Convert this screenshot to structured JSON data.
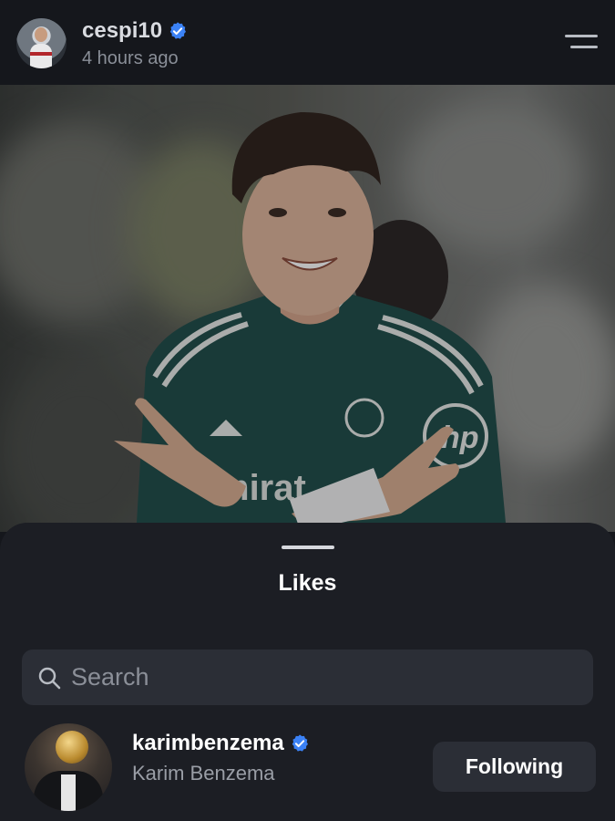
{
  "post": {
    "username": "cespi10",
    "verified": true,
    "time_ago": "4 hours ago",
    "menu_icon": "menu-icon"
  },
  "photo": {
    "icon": "player-photo",
    "jersey_text": "mirat"
  },
  "likes_sheet": {
    "title": "Likes",
    "search_placeholder": "Search",
    "search_value": "",
    "users": [
      {
        "username": "karimbenzema",
        "verified": true,
        "full_name": "Karim Benzema",
        "button_label": "Following"
      }
    ]
  },
  "colors": {
    "background": "#15171c",
    "sheet": "#1c1e24",
    "input": "#2b2e36",
    "verified_blue": "#3b82f6",
    "muted_text": "#8a8f98",
    "jersey_green": "#1f4d48"
  }
}
